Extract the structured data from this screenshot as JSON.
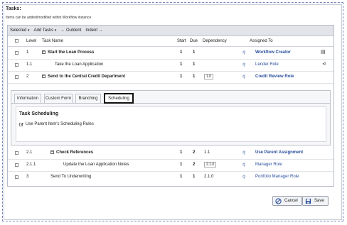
{
  "panel": {
    "title": "Tasks:",
    "subtitle": "Items can be added/modified within Workflow instance"
  },
  "toolbar": {
    "selected_label": "Selected",
    "add_tasks_label": "Add Tasks",
    "outdent_label": "Outdent",
    "indent_label": "Indent"
  },
  "columns": {
    "level": "Level",
    "task_name": "Task Name",
    "start": "Start",
    "due": "Due",
    "dependency": "Dependency",
    "assigned_to": "Assigned To"
  },
  "rows": [
    {
      "level": "1",
      "task": "Start the Loan Process",
      "start": "1",
      "due": "1",
      "dependency": "",
      "assigned": "Workflow Creator",
      "bold": true
    },
    {
      "level": "1.1",
      "task": "Take the Loan Application",
      "start": "1",
      "due": "1",
      "dependency": "",
      "assigned": "Lender Role",
      "bold": false
    },
    {
      "level": "2",
      "task": "Send to the Central Credit Department",
      "start": "1",
      "due": "1",
      "dependency": "1.0",
      "assigned": "Credit Review Role",
      "bold": true
    },
    {
      "level": "2.1",
      "task": "Check References",
      "start": "1",
      "due": "2",
      "dependency": "1.1",
      "assigned": "Use Parent Assignment",
      "bold": true
    },
    {
      "level": "2.1.1",
      "task": "Update the Loan Application Notes",
      "start": "1",
      "due": "2",
      "dependency": "2.1.0",
      "assigned": "Manager Role",
      "bold": false
    },
    {
      "level": "3",
      "task": "Send To Underwriting",
      "start": "1",
      "due": "1",
      "dependency": "2.1.0",
      "assigned": "Portfolio Manager Role",
      "bold": false
    }
  ],
  "detail": {
    "tabs": [
      "Information",
      "Custom Form",
      "Branching",
      "Scheduling"
    ],
    "active_tab": "Scheduling",
    "section_title": "Task Scheduling",
    "checkbox_label": "Use Parent Item's Scheduling Rules"
  },
  "buttons": {
    "cancel": "Cancel",
    "save": "Save"
  },
  "colors": {
    "link": "#2a4f9c",
    "toolbar_bg": "#e2e4ea",
    "frame_dash": "#7a86b8"
  }
}
